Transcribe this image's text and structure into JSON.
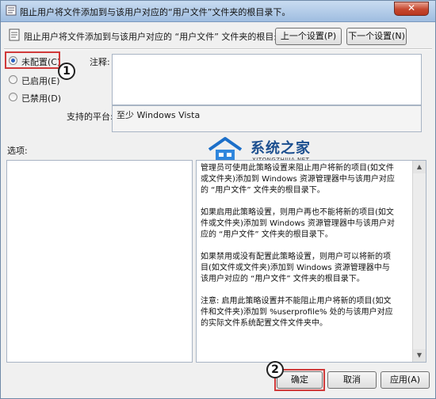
{
  "window": {
    "title": "阻止用户将文件添加到与该用户对应的“用户文件”文件夹的根目录下。",
    "close_symbol": "✕"
  },
  "header": {
    "policy_name": "阻止用户将文件添加到与该用户对应的 “用户文件” 文件夹的根目录下。",
    "prev_button": "上一个设置(P)",
    "next_button": "下一个设置(N)"
  },
  "state_options": [
    {
      "label": "未配置(C)",
      "selected": true
    },
    {
      "label": "已启用(E)",
      "selected": false
    },
    {
      "label": "已禁用(D)",
      "selected": false
    }
  ],
  "comment": {
    "label": "注释:",
    "value": ""
  },
  "platform": {
    "label": "支持的平台:",
    "value": "至少 Windows Vista"
  },
  "options_label": "选项:",
  "help": {
    "paragraphs": [
      "管理员可使用此策略设置来阻止用户将新的项目(如文件或文件夹)添加到 Windows 资源管理器中与该用户对应的 “用户文件” 文件夹的根目录下。",
      "如果启用此策略设置，则用户再也不能将新的项目(如文件或文件夹)添加到 Windows 资源管理器中与该用户对应的 “用户文件” 文件夹的根目录下。",
      "如果禁用或没有配置此策略设置，则用户可以将新的项目(如文件或文件夹)添加到 Windows 资源管理器中与该用户对应的 “用户文件” 文件夹的根目录下。",
      "注意: 启用此策略设置并不能阻止用户将新的项目(如文件和文件夹)添加到 %userprofile% 处的与该用户对应的实际文件系统配置文件文件夹中。"
    ]
  },
  "footer": {
    "ok_button": "确定",
    "cancel_button": "取消",
    "apply_button": "应用(A)"
  },
  "annotations": {
    "step1": "1",
    "step2": "2"
  },
  "watermark": {
    "name": "系统之家",
    "url": "XITONGZHIJIA.NET"
  },
  "colors": {
    "title_gradient_top": "#c9dcf1",
    "close_red": "#c6482f",
    "highlight_red": "#d03a3a",
    "watermark_blue": "#1c4f8f"
  }
}
